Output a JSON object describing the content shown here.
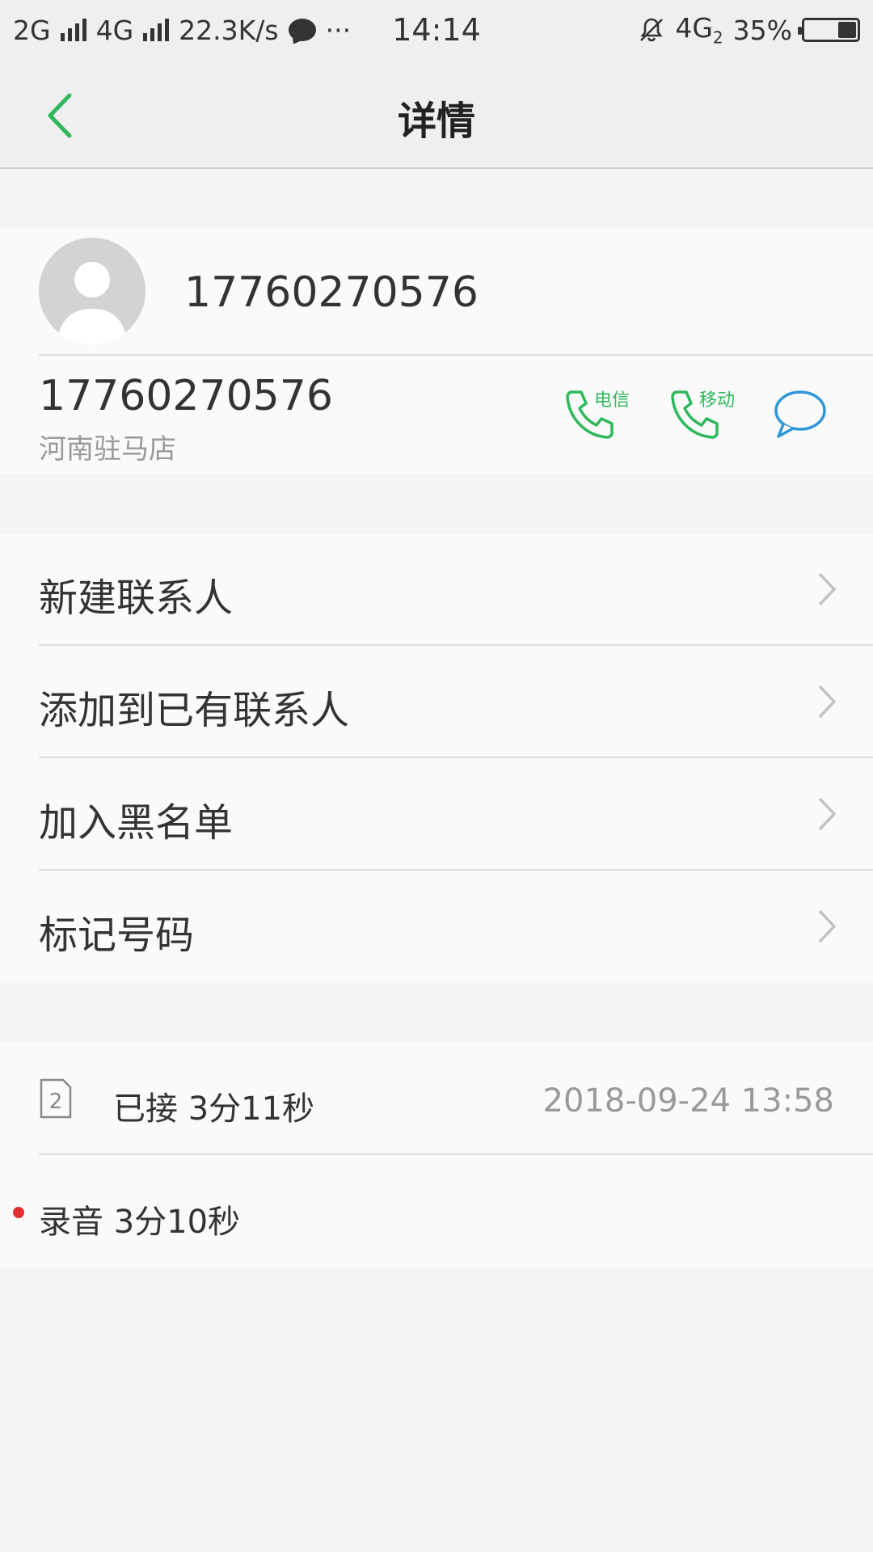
{
  "status_bar": {
    "net1": "2G",
    "net2": "4G",
    "speed": "22.3K/s",
    "more": "···",
    "time": "14:14",
    "net3": "4G",
    "net3_sub": "2",
    "battery": "35%"
  },
  "header": {
    "title": "详情"
  },
  "contact": {
    "name": "17760270576",
    "number": "17760270576",
    "location": "河南驻马店",
    "carrier1": "电信",
    "carrier2": "移动"
  },
  "menu": {
    "items": [
      {
        "label": "新建联系人"
      },
      {
        "label": "添加到已有联系人"
      },
      {
        "label": "加入黑名单"
      },
      {
        "label": "标记号码"
      }
    ]
  },
  "call_log": {
    "sim": "2",
    "status": "已接 3分11秒",
    "datetime": "2018-09-24 13:58",
    "recording": "录音 3分10秒"
  },
  "colors": {
    "accent_green": "#2eb85c",
    "message_blue": "#2f96d8",
    "record_red": "#e23030"
  }
}
